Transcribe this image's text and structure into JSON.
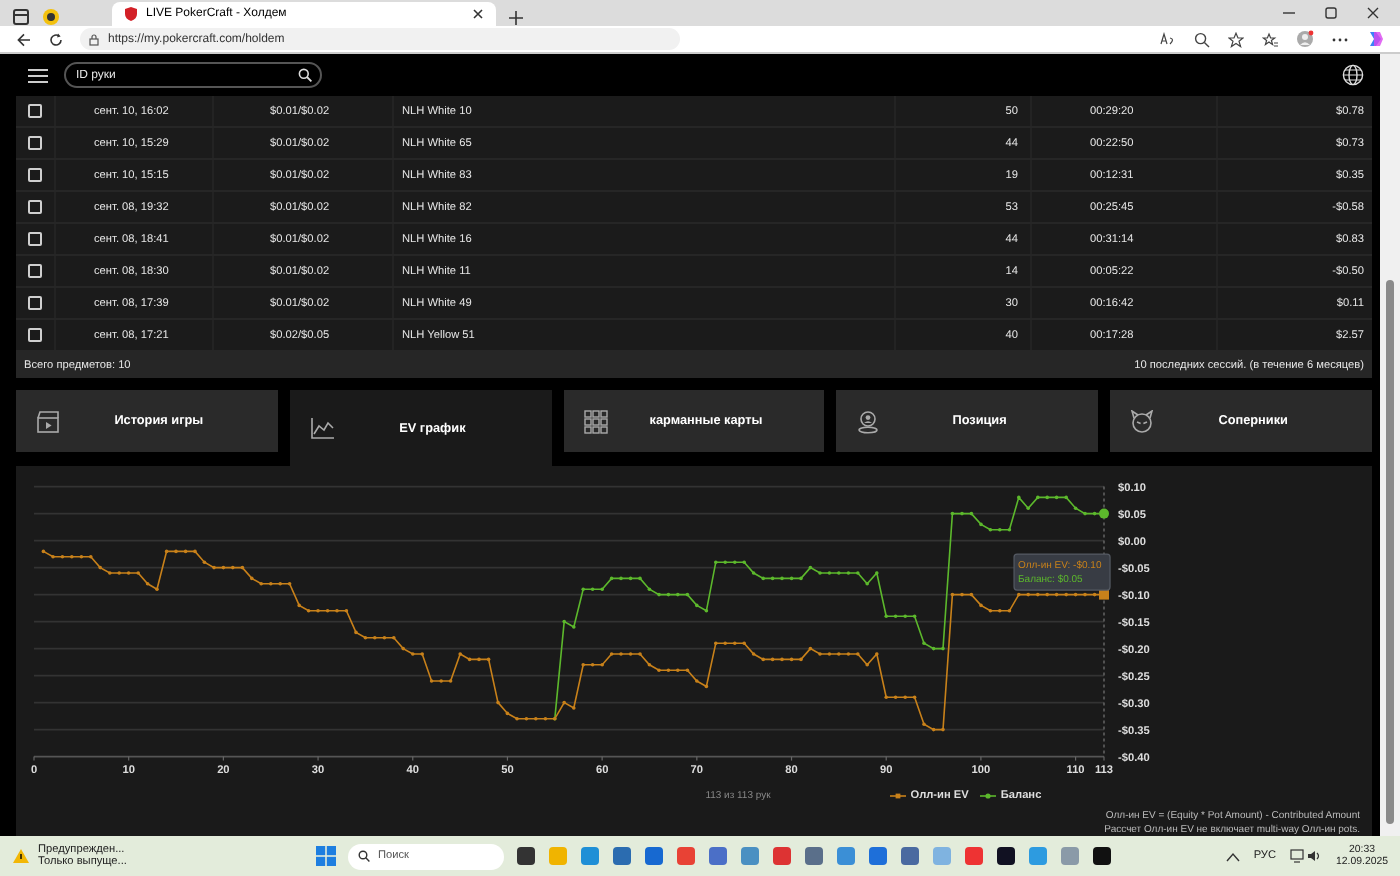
{
  "browser": {
    "tab_title": "LIVE PokerCraft - Холдем",
    "address": "https://my.pokercraft.com/holdem"
  },
  "header": {
    "search": {
      "placeholder": "ID руки"
    }
  },
  "sessions": {
    "rows": [
      {
        "checked": false,
        "date": "сент. 10, 16:02",
        "stakes": "$0.01/$0.02",
        "table": "NLH White 10",
        "hands": "50",
        "duration": "00:29:20",
        "result": "$0.78"
      },
      {
        "checked": false,
        "date": "сент. 10, 15:29",
        "stakes": "$0.01/$0.02",
        "table": "NLH White 65",
        "hands": "44",
        "duration": "00:22:50",
        "result": "$0.73"
      },
      {
        "checked": false,
        "date": "сент. 10, 15:15",
        "stakes": "$0.01/$0.02",
        "table": "NLH White 83",
        "hands": "19",
        "duration": "00:12:31",
        "result": "$0.35"
      },
      {
        "checked": false,
        "date": "сент. 08, 19:32",
        "stakes": "$0.01/$0.02",
        "table": "NLH White 82",
        "hands": "53",
        "duration": "00:25:45",
        "result": "-$0.58"
      },
      {
        "checked": false,
        "date": "сент. 08, 18:41",
        "stakes": "$0.01/$0.02",
        "table": "NLH White 16",
        "hands": "44",
        "duration": "00:31:14",
        "result": "$0.83"
      },
      {
        "checked": false,
        "date": "сент. 08, 18:30",
        "stakes": "$0.01/$0.02",
        "table": "NLH White 11",
        "hands": "14",
        "duration": "00:05:22",
        "result": "-$0.50"
      },
      {
        "checked": false,
        "date": "сент. 08, 17:39",
        "stakes": "$0.01/$0.02",
        "table": "NLH White 49",
        "hands": "30",
        "duration": "00:16:42",
        "result": "$0.11"
      },
      {
        "checked": false,
        "date": "сент. 08, 17:21",
        "stakes": "$0.02/$0.05",
        "table": "NLH Yellow 51",
        "hands": "40",
        "duration": "00:17:28",
        "result": "$2.57"
      }
    ],
    "total": "Всего предметов: 10",
    "summary": "10 последних сессий. (в течение 6 месяцев)"
  },
  "section_tabs": [
    {
      "label": "История игры",
      "kind": "clapper",
      "selected": false
    },
    {
      "label": "EV график",
      "kind": "chart",
      "selected": true
    },
    {
      "label": "карманные карты",
      "kind": "grid",
      "selected": false
    },
    {
      "label": "Позиция",
      "kind": "position",
      "selected": false
    },
    {
      "label": "Соперники",
      "kind": "opponent",
      "selected": false
    }
  ],
  "ev_chart": {
    "chart_data": {
      "type": "line",
      "x": [
        1,
        2,
        3,
        4,
        5,
        6,
        7,
        8,
        9,
        10,
        11,
        12,
        13,
        14,
        15,
        16,
        17,
        18,
        19,
        20,
        21,
        22,
        23,
        24,
        25,
        26,
        27,
        28,
        29,
        30,
        31,
        32,
        33,
        34,
        35,
        36,
        37,
        38,
        39,
        40,
        41,
        42,
        43,
        44,
        45,
        46,
        47,
        48,
        49,
        50,
        51,
        52,
        53,
        54,
        55,
        56,
        57,
        58,
        59,
        60,
        61,
        62,
        63,
        64,
        65,
        66,
        67,
        68,
        69,
        70,
        71,
        72,
        73,
        74,
        75,
        76,
        77,
        78,
        79,
        80,
        81,
        82,
        83,
        84,
        85,
        86,
        87,
        88,
        89,
        90,
        91,
        92,
        93,
        94,
        95,
        96,
        97,
        98,
        99,
        100,
        101,
        102,
        103,
        104,
        105,
        106,
        107,
        108,
        109,
        110,
        111,
        112,
        113
      ],
      "series": [
        {
          "name": "Олл-ин EV",
          "color": "#c8811a",
          "values": [
            -0.02,
            -0.03,
            -0.03,
            -0.03,
            -0.03,
            -0.03,
            -0.05,
            -0.06,
            -0.06,
            -0.06,
            -0.06,
            -0.08,
            -0.09,
            -0.02,
            -0.02,
            -0.02,
            -0.02,
            -0.04,
            -0.05,
            -0.05,
            -0.05,
            -0.05,
            -0.07,
            -0.08,
            -0.08,
            -0.08,
            -0.08,
            -0.12,
            -0.13,
            -0.13,
            -0.13,
            -0.13,
            -0.13,
            -0.17,
            -0.18,
            -0.18,
            -0.18,
            -0.18,
            -0.2,
            -0.21,
            -0.21,
            -0.26,
            -0.26,
            -0.26,
            -0.21,
            -0.22,
            -0.22,
            -0.22,
            -0.3,
            -0.32,
            -0.33,
            -0.33,
            -0.33,
            -0.33,
            -0.33,
            -0.3,
            -0.31,
            -0.23,
            -0.23,
            -0.23,
            -0.21,
            -0.21,
            -0.21,
            -0.21,
            -0.23,
            -0.24,
            -0.24,
            -0.24,
            -0.24,
            -0.26,
            -0.27,
            -0.19,
            -0.19,
            -0.19,
            -0.19,
            -0.21,
            -0.22,
            -0.22,
            -0.22,
            -0.22,
            -0.22,
            -0.2,
            -0.21,
            -0.21,
            -0.21,
            -0.21,
            -0.21,
            -0.23,
            -0.21,
            -0.29,
            -0.29,
            -0.29,
            -0.29,
            -0.34,
            -0.35,
            -0.35,
            -0.1,
            -0.1,
            -0.1,
            -0.12,
            -0.13,
            -0.13,
            -0.13,
            -0.1,
            -0.1,
            -0.1,
            -0.1,
            -0.1,
            -0.1,
            -0.1,
            -0.1,
            -0.1,
            -0.1
          ]
        },
        {
          "name": "Баланс",
          "color": "#5cb82c",
          "values": [
            null,
            null,
            null,
            null,
            null,
            null,
            null,
            null,
            null,
            null,
            null,
            null,
            null,
            null,
            null,
            null,
            null,
            null,
            null,
            null,
            null,
            null,
            null,
            null,
            null,
            null,
            null,
            null,
            null,
            null,
            null,
            null,
            null,
            null,
            null,
            null,
            null,
            null,
            null,
            null,
            null,
            null,
            null,
            null,
            null,
            null,
            null,
            null,
            null,
            null,
            null,
            null,
            null,
            null,
            -0.33,
            -0.15,
            -0.16,
            -0.09,
            -0.09,
            -0.09,
            -0.07,
            -0.07,
            -0.07,
            -0.07,
            -0.09,
            -0.1,
            -0.1,
            -0.1,
            -0.1,
            -0.12,
            -0.13,
            -0.04,
            -0.04,
            -0.04,
            -0.04,
            -0.06,
            -0.07,
            -0.07,
            -0.07,
            -0.07,
            -0.07,
            -0.05,
            -0.06,
            -0.06,
            -0.06,
            -0.06,
            -0.06,
            -0.08,
            -0.06,
            -0.14,
            -0.14,
            -0.14,
            -0.14,
            -0.19,
            -0.2,
            -0.2,
            0.05,
            0.05,
            0.05,
            0.03,
            0.02,
            0.02,
            0.02,
            0.08,
            0.06,
            0.08,
            0.08,
            0.08,
            0.08,
            0.06,
            0.05,
            0.05,
            0.05
          ]
        }
      ],
      "grid": true,
      "xlim": [
        0,
        113
      ],
      "ylim": [
        -0.4,
        0.1
      ],
      "xticks": [
        0,
        10,
        20,
        30,
        40,
        50,
        60,
        70,
        80,
        90,
        100,
        110,
        113
      ],
      "yticks": [
        {
          "value": 0.1,
          "label": "$0.10"
        },
        {
          "value": 0.05,
          "label": "$0.05"
        },
        {
          "value": 0,
          "label": "$0.00"
        },
        {
          "value": -0.05,
          "label": "-$0.05"
        },
        {
          "value": -0.1,
          "label": "-$0.10"
        },
        {
          "value": -0.15,
          "label": "-$0.15"
        },
        {
          "value": -0.2,
          "label": "-$0.20"
        },
        {
          "value": -0.25,
          "label": "-$0.25"
        },
        {
          "value": -0.3,
          "label": "-$0.30"
        },
        {
          "value": -0.35,
          "label": "-$0.35"
        },
        {
          "value": -0.4,
          "label": "-$0.40"
        }
      ]
    },
    "tooltip": [
      "Олл-ин EV: -$0.10",
      "Баланс: $0.05"
    ],
    "caption": "113 из 113 рук",
    "footnotes": [
      "Олл-ин EV = (Equity * Pot Amount) - Contributed Amount",
      "Рассчет Олл-ин EV не включает multi-way Олл-ин pots."
    ]
  },
  "taskbar": {
    "notification": {
      "title": "Предупрежден...",
      "text": "Только выпуще..."
    },
    "search": {
      "placeholder": "Поиск"
    },
    "language": "РУС",
    "time": "20:33",
    "date": "12.09.2025"
  }
}
